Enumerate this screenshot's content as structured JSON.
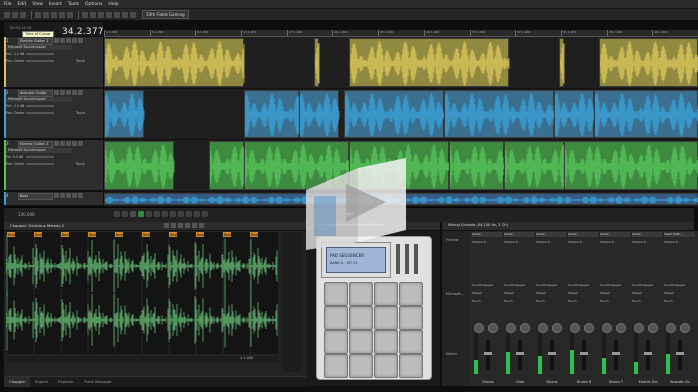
{
  "menu": [
    "File",
    "Edit",
    "View",
    "Insert",
    "Tools",
    "Options",
    "Help"
  ],
  "toolbar": {
    "snap": "50th Fields Gaming"
  },
  "time": {
    "main": "34.2.377",
    "secondary": "00:01:14:16"
  },
  "tooltip": "Time of Cursor",
  "ruler_labels": [
    "1.1.000",
    "5.1.000",
    "9.1.000",
    "13.1.000",
    "17.1.000",
    "21.1.000",
    "25.1.000",
    "29.1.000",
    "33.1.000",
    "37.1.000",
    "41.1.000",
    "45.1.000",
    "49.1.000"
  ],
  "tracks": [
    {
      "num": "1",
      "name": "Electric Guitar 1",
      "fx": "Microsoft Soundmapper",
      "vol_label": "Vol: -1.5 dB",
      "pan_label": "Pan: Center",
      "touch": "Touch",
      "color": "#d8c35a",
      "clip_color": "#8f8a3f"
    },
    {
      "num": "2",
      "name": "Acoustic Guitar",
      "fx": "Microsoft Soundmapper",
      "vol_label": "Vol: -1.5 dB",
      "pan_label": "Pan: Center",
      "touch": "Touch",
      "color": "#3aa0d6",
      "clip_color": "#3b6f8f"
    },
    {
      "num": "3",
      "name": "Electric Guitar 2",
      "fx": "Microsoft Soundmapper",
      "vol_label": "Vol: 0.0 dB",
      "pan_label": "Pan: Center",
      "touch": "Touch",
      "color": "#56c25a",
      "clip_color": "#3e8a3e"
    },
    {
      "num": "4",
      "name": "Bass",
      "fx": "",
      "vol_label": "",
      "pan_label": "",
      "touch": "",
      "color": "#3aa0d6",
      "clip_color": "#355d84"
    }
  ],
  "transport": {
    "position": "1.1.000",
    "rate": "130.000",
    "end": "Sel: 4/4"
  },
  "chopper": {
    "title": "Chopper: Delicious Melody 2",
    "markers": [
      "Beat",
      "Beat",
      "Beat",
      "Beat",
      "Beat",
      "Beat",
      "Beat",
      "Beat",
      "Beat",
      "Beat"
    ],
    "length": "1.1.000",
    "tabs": [
      "Chopper",
      "Project",
      "Explorer",
      "Track Manager"
    ]
  },
  "plugin": {
    "title": "Serif Spect Progression Track Engine",
    "lcd_line1": "PAD SEQUENCER",
    "lcd_line2": "BANK A - KIT 01"
  },
  "mixer": {
    "title": "Mixing Console (44,100 Hz, 1 Ch)",
    "row_labels": [
      "Preview",
      "Microsoft...",
      "Master"
    ],
    "strips": [
      {
        "head": "Audio",
        "name": "Chorus",
        "fx": "VEGAS Tr...",
        "route": "Soundmapper",
        "mode": "Touch",
        "vu": 0.35
      },
      {
        "head": "Audio",
        "name": "Choir",
        "fx": "VEGAS Tr...",
        "route": "Soundmapper",
        "mode": "Touch",
        "vu": 0.55
      },
      {
        "head": "Audio",
        "name": "Drums",
        "fx": "VEGAS Tr...",
        "route": "Soundmapper",
        "mode": "Touch",
        "vu": 0.45
      },
      {
        "head": "Audio",
        "name": "Drums H",
        "fx": "VEGAS Tr...",
        "route": "Soundmapper",
        "mode": "Touch",
        "vu": 0.6
      },
      {
        "head": "Audio",
        "name": "Drums T",
        "fx": "VEGAS Tr...",
        "route": "Soundmapper",
        "mode": "Touch",
        "vu": 0.4
      },
      {
        "head": "Audio",
        "name": "Electric Gui",
        "fx": "VEGAS Tr...",
        "route": "Soundmapper",
        "mode": "Touch",
        "vu": 0.3
      },
      {
        "head": "Insert Sott...",
        "name": "Acoustic Gu",
        "fx": "VEGAS Tr...",
        "route": "Soundmapper",
        "mode": "Touch",
        "vu": 0.5
      }
    ]
  },
  "colors": {
    "accent_green": "#56c25a",
    "accent_yellow": "#d8c35a",
    "accent_blue": "#3aa0d6"
  }
}
